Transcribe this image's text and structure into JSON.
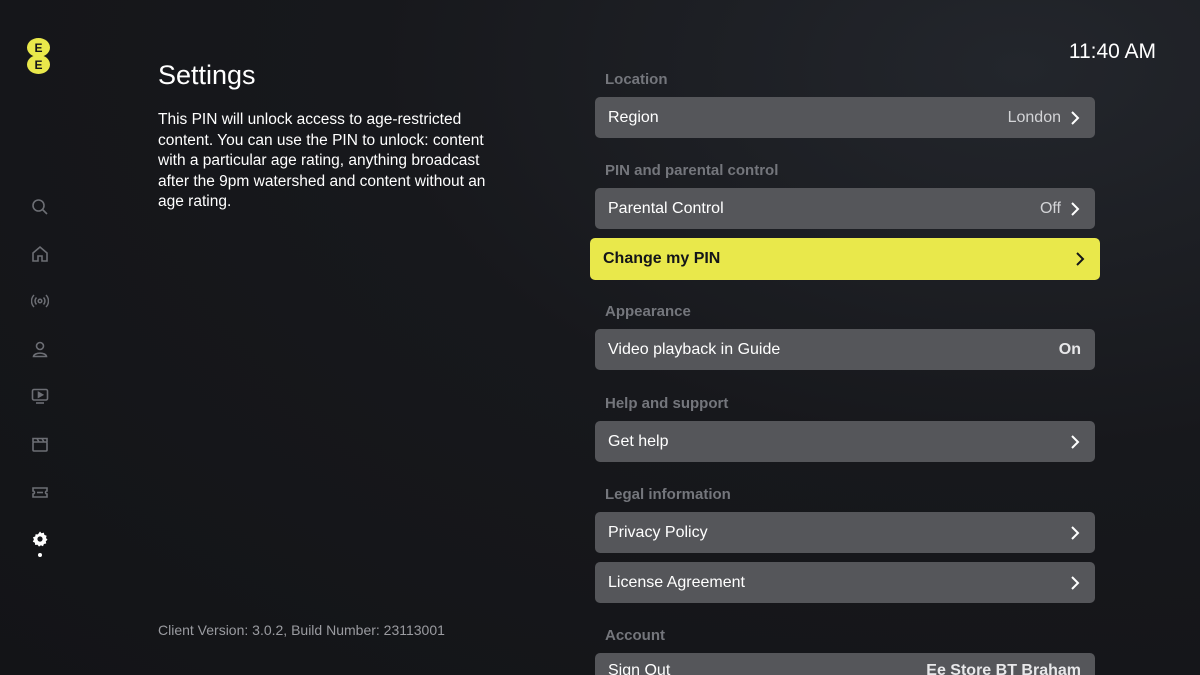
{
  "brand": {
    "logo_letters": [
      "E",
      "E"
    ],
    "accent": "#e9e84b"
  },
  "clock": "11:40 AM",
  "page": {
    "title": "Settings",
    "description": "This PIN will unlock access to age-restricted content. You can use the PIN to unlock: content with a particular age rating, anything broadcast after the 9pm watershed and content without an age rating.",
    "version": "Client Version: 3.0.2, Build Number: 23113001"
  },
  "sidebar": {
    "items": [
      {
        "icon": "search-icon"
      },
      {
        "icon": "home-icon"
      },
      {
        "icon": "broadcast-icon"
      },
      {
        "icon": "profile-icon"
      },
      {
        "icon": "tv-icon"
      },
      {
        "icon": "clapperboard-icon"
      },
      {
        "icon": "ticket-icon"
      },
      {
        "icon": "gear-icon",
        "active": true
      }
    ]
  },
  "settings": {
    "sections": {
      "location": "Location",
      "pin": "PIN and parental control",
      "appearance": "Appearance",
      "help": "Help and support",
      "legal": "Legal information",
      "account": "Account"
    },
    "rows": {
      "region": {
        "label": "Region",
        "value": "London"
      },
      "parental": {
        "label": "Parental Control",
        "value": "Off"
      },
      "change_pin": {
        "label": "Change my PIN"
      },
      "video_playback": {
        "label": "Video playback in Guide",
        "value": "On"
      },
      "get_help": {
        "label": "Get help"
      },
      "privacy": {
        "label": "Privacy Policy"
      },
      "license": {
        "label": "License Agreement"
      },
      "sign_out": {
        "label": "Sign Out",
        "value": "Ee Store BT Braham"
      }
    }
  }
}
